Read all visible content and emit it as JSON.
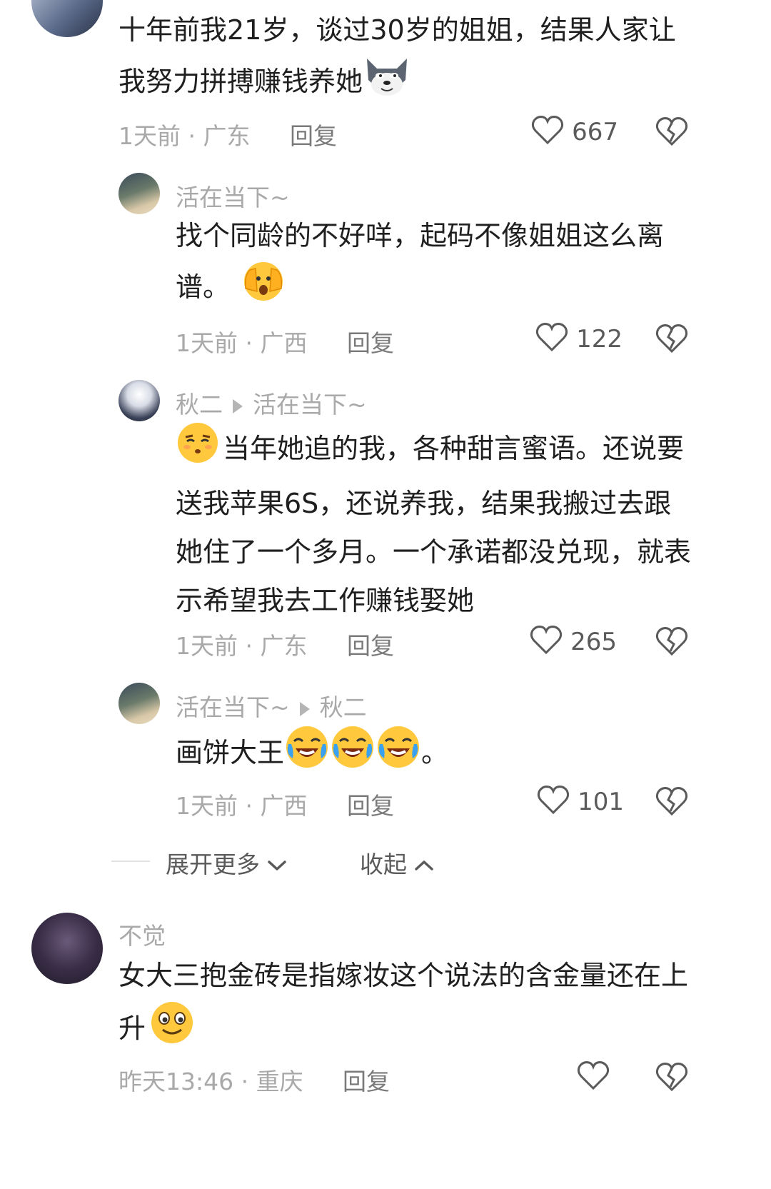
{
  "comments": [
    {
      "text": "十年前我21岁，谈过30岁的姐姐，结果人家让我努力拼搏赚钱养她",
      "time": "1天前",
      "location": "广东",
      "reply_label": "回复",
      "likes": "667"
    },
    {
      "author": "活在当下~",
      "text": "找个同龄的不好咩，起码不像姐姐这么离谱。",
      "time": "1天前",
      "location": "广西",
      "reply_label": "回复",
      "likes": "122"
    },
    {
      "author": "秋二",
      "reply_to": "活在当下~",
      "text": "当年她追的我，各种甜言蜜语。还说要送我苹果6S，还说养我，结果我搬过去跟她住了一个多月。一个承诺都没兑现，就表示希望我去工作赚钱娶她",
      "time": "1天前",
      "location": "广东",
      "reply_label": "回复",
      "likes": "265"
    },
    {
      "author": "活在当下~",
      "reply_to": "秋二",
      "text": "画饼大王",
      "text_suffix": "。",
      "time": "1天前",
      "location": "广西",
      "reply_label": "回复",
      "likes": "101"
    },
    {
      "author": "不觉",
      "text": "女大三抱金砖是指嫁妆这个说法的含金量还在上升",
      "time": "昨天13:46",
      "location": "重庆",
      "reply_label": "回复",
      "likes": ""
    }
  ],
  "thread_controls": {
    "expand_label": "展开更多",
    "collapse_label": "收起"
  },
  "separator": " · ",
  "icons": {
    "like": "heart-outline-icon",
    "dislike": "broken-heart-icon",
    "expand": "chevron-down-icon",
    "collapse": "chevron-up-icon"
  },
  "colors": {
    "meta_gray": "#a9a9a9",
    "text": "#1f1f1f",
    "emoji_yellow": "#ffc83d"
  }
}
